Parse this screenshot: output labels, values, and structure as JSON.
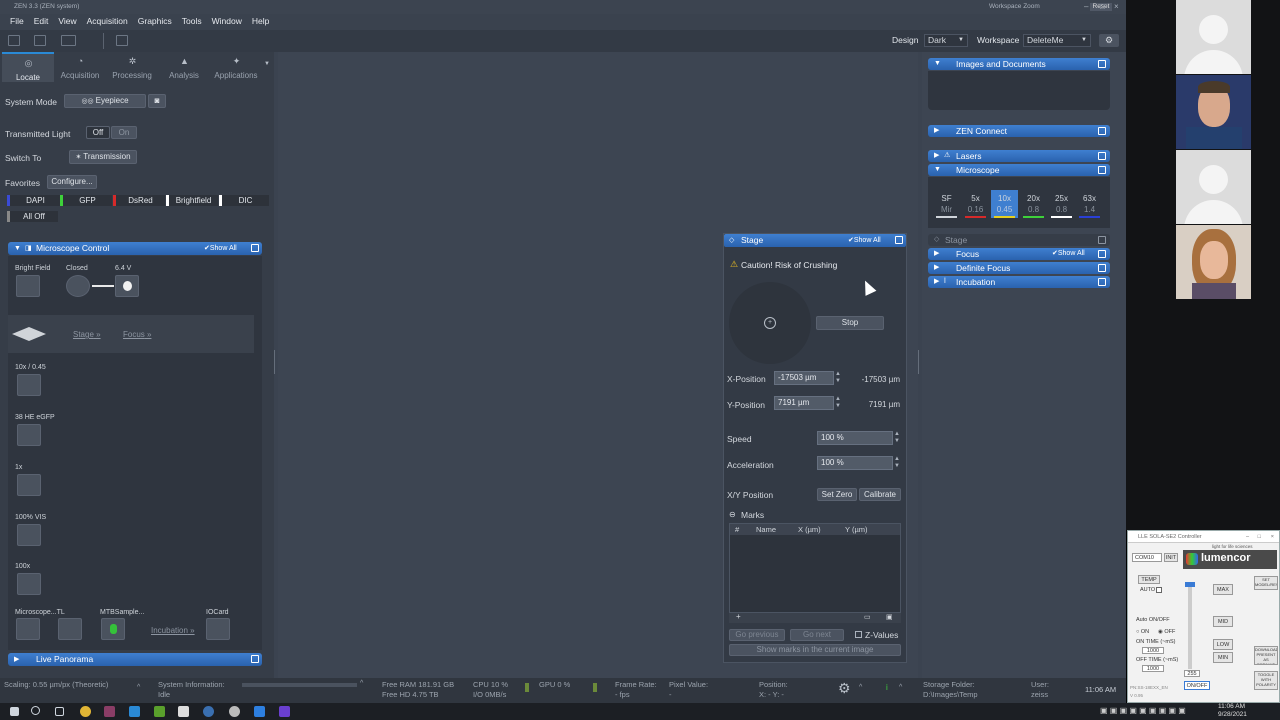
{
  "window": {
    "title": "ZEN 3.3 (ZEN system)",
    "workspace_zoom": "Workspace Zoom",
    "reset": "Reset"
  },
  "menu": [
    "File",
    "Edit",
    "View",
    "Acquisition",
    "Graphics",
    "Tools",
    "Window",
    "Help"
  ],
  "toolbar": {
    "design_label": "Design",
    "design_value": "Dark",
    "workspace_label": "Workspace",
    "workspace_value": "DeleteMe"
  },
  "tabs": [
    "Locate",
    "Acquisition",
    "Processing",
    "Analysis",
    "Applications"
  ],
  "locate": {
    "system_mode_label": "System Mode",
    "eyepiece": "Eyepiece",
    "transmitted_light_label": "Transmitted Light",
    "off": "Off",
    "on": "On",
    "switch_to_label": "Switch To",
    "transmission": "Transmission",
    "favorites_label": "Favorites",
    "configure": "Configure...",
    "filters": [
      {
        "name": "DAPI",
        "color": "#3a4bd6"
      },
      {
        "name": "GFP",
        "color": "#3ed13a"
      },
      {
        "name": "DsRed",
        "color": "#d62a2a"
      },
      {
        "name": "Brightfield",
        "color": "#ffffff"
      },
      {
        "name": "DIC",
        "color": "#ffffff"
      }
    ],
    "all_off": "All Off"
  },
  "microscope_control": {
    "title": "Microscope Control",
    "show_all": "Show All",
    "bright_field": "Bright Field",
    "closed": "Closed",
    "voltage": "6.4 V",
    "stage_link": "Stage",
    "focus_link": "Focus",
    "objective": "10x / 0.45",
    "filter_cube": "38 HE eGFP",
    "optovar": "1x",
    "vis": "100% VIS",
    "eyepiece_mag": "100x",
    "microscope_tl": "Microscope...TL",
    "mtb_sample": "MTBSample...",
    "incubation": "Incubation",
    "iocard": "IOCard"
  },
  "live_panorama": "Live Panorama",
  "stage_panel": {
    "title": "Stage",
    "show_all": "Show All",
    "caution": "Caution! Risk of Crushing",
    "stop": "Stop",
    "x_label": "X-Position",
    "x_value": "-17503 µm",
    "x_readout": "-17503 µm",
    "y_label": "Y-Position",
    "y_value": "7191 µm",
    "y_readout": "7191 µm",
    "speed_label": "Speed",
    "speed_value": "100 %",
    "accel_label": "Acceleration",
    "accel_value": "100 %",
    "xy_label": "X/Y Position",
    "set_zero": "Set Zero",
    "calibrate": "Calibrate",
    "marks_label": "Marks",
    "marks_columns": [
      "#",
      "Name",
      "X (µm)",
      "Y (µm)"
    ],
    "go_previous": "Go previous",
    "go_next": "Go next",
    "z_positions": "Z-Values",
    "show_marks": "Show marks in the current image"
  },
  "right_panel": {
    "images_docs": "Images and Documents",
    "zen_connect": "ZEN Connect",
    "lasers": "Lasers",
    "microscope": "Microscope",
    "objectives": [
      {
        "name": "SF",
        "na": "Mir",
        "color": "#cfd4da"
      },
      {
        "name": "5x",
        "na": "0.16",
        "color": "#d62a2a"
      },
      {
        "name": "10x",
        "na": "0.45",
        "color": "#e6d020"
      },
      {
        "name": "20x",
        "na": "0.8",
        "color": "#3ed13a"
      },
      {
        "name": "25x",
        "na": "0.8",
        "color": "#ffffff"
      },
      {
        "name": "63x",
        "na": "1.4",
        "color": "#2a3fd6"
      }
    ],
    "stage": "Stage",
    "focus": "Focus",
    "show_all": "Show All",
    "definite_focus": "Definite Focus",
    "incubation": "Incubation"
  },
  "status": {
    "scaling": "Scaling:  0.55 µm/px (Theoretic)",
    "system_info": "System Information:",
    "idle": "Idle",
    "free_ram": "Free RAM  181.91 GB",
    "free_hd": "Free HD     4.75 TB",
    "cpu": "CPU  10 %",
    "io": "I/O   0MB/s",
    "gpu": "GPU  0 %",
    "frame_rate": "Frame Rate:",
    "fps": "- fps",
    "pixel_value": "Pixel Value:",
    "pixel_dash": "-",
    "position": "Position:",
    "pos_xy": "X: -      Y: -",
    "storage_folder": "Storage Folder:",
    "storage_path": "D:\\Images\\Temp",
    "user": "User:",
    "user_name": "zeiss",
    "time": "11:06 AM"
  },
  "taskbar": {
    "time": "11:06 AM",
    "date": "9/28/2021"
  },
  "lumencor": {
    "title": "LLE SOLA-SE2 Controller",
    "port": "COM10",
    "init": "INIT",
    "logo": "lumencor",
    "tagline": "light for life sciences",
    "temp": "TEMP",
    "auto": "AUTO",
    "max": "MAX",
    "mid": "MID",
    "low": "LOW",
    "min": "MIN",
    "set_model": "SET MODEL/REV",
    "auto_onoff": "Auto ON/OFF",
    "on": "ON",
    "off": "OFF",
    "on_time": "ON TIME (~mS)",
    "on_time_val": "1000",
    "off_time": "OFF TIME (~mS)",
    "off_time_val": "1000",
    "level": "255",
    "onoff": "ON/OFF",
    "download": "DOWNLOAD PRESENT AS DEFAULT",
    "toggle": "TOGGLE WITH POLARITY",
    "serial": "PN:SS-18EXX_EN",
    "version": "V 0.95"
  }
}
